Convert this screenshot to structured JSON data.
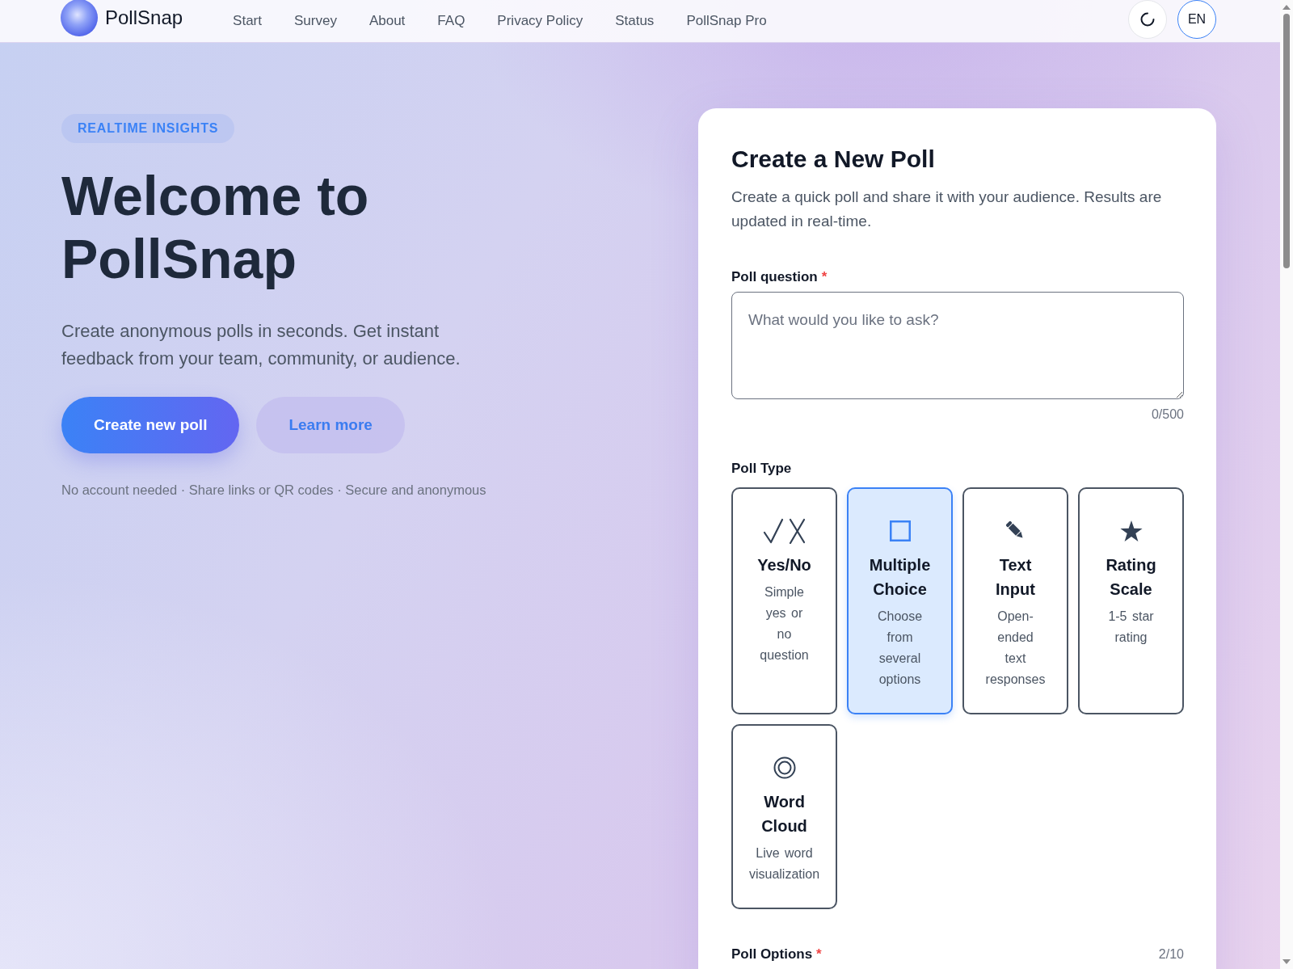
{
  "nav": {
    "brand": "PollSnap",
    "links": [
      "Start",
      "Survey",
      "About",
      "FAQ",
      "Privacy Policy",
      "Status",
      "PollSnap Pro"
    ],
    "language": "EN"
  },
  "hero": {
    "badge": "REALTIME INSIGHTS",
    "title": "Welcome to PollSnap",
    "subtitle": "Create anonymous polls in seconds. Get instant feedback from your team, community, or audience.",
    "buttons": [
      {
        "label": "Create new poll",
        "kind": "primary"
      },
      {
        "label": "Learn more",
        "kind": "secondary"
      }
    ],
    "footnote": "No account needed · Share links or QR codes · Secure and anonymous"
  },
  "poll_form": {
    "title": "Create a New Poll",
    "description": "Create a quick poll and share it with your audience. Results are updated in real-time.",
    "question": {
      "label": "Poll question",
      "required_mark": "*",
      "placeholder": "What would you like to ask?",
      "counter": "0/500"
    },
    "poll_type": {
      "label": "Poll Type",
      "options": [
        {
          "kind": "yes_no",
          "title": "Yes/No",
          "description": "Simple yes or no question",
          "selected": false
        },
        {
          "kind": "multiple_choice",
          "title": "Multiple Choice",
          "description": "Choose from several options",
          "selected": true
        },
        {
          "kind": "text_input",
          "title": "Text Input",
          "description": "Open-ended text responses",
          "selected": false
        },
        {
          "kind": "rating_scale",
          "title": "Rating Scale",
          "description": "1-5 star rating",
          "selected": false
        },
        {
          "kind": "word_cloud",
          "title": "Word Cloud",
          "description": "Live word visualization",
          "selected": false
        }
      ]
    },
    "poll_options": {
      "label": "Poll Options",
      "required_mark": "*",
      "counter": "2/10"
    }
  }
}
